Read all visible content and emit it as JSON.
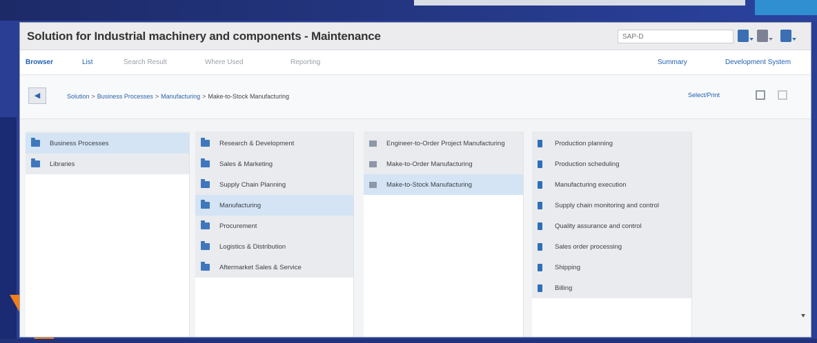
{
  "window": {
    "title": "Solution for Industrial machinery and components - Maintenance",
    "search_placeholder": "SAP-D"
  },
  "tabs": [
    {
      "label": "Browser"
    },
    {
      "label": "List"
    },
    {
      "label": "Search Result"
    },
    {
      "label": "Where Used"
    },
    {
      "label": "Reporting"
    }
  ],
  "right_menus": {
    "summary": "Summary",
    "dev_system": "Development System"
  },
  "breadcrumb": {
    "items": [
      "Solution",
      "Business Processes",
      "Manufacturing",
      "Make-to-Stock Manufacturing"
    ]
  },
  "toolbar": {
    "select_menu": "Select/Print"
  },
  "columns": {
    "col1": [
      {
        "label": "Business Processes",
        "selected": true
      },
      {
        "label": "Libraries",
        "selected": false
      }
    ],
    "col2": [
      {
        "label": "Research & Development",
        "selected": false
      },
      {
        "label": "Sales & Marketing",
        "selected": false
      },
      {
        "label": "Supply Chain Planning",
        "selected": false
      },
      {
        "label": "Manufacturing",
        "selected": true
      },
      {
        "label": "Procurement",
        "selected": false
      },
      {
        "label": "Logistics & Distribution",
        "selected": false
      },
      {
        "label": "Aftermarket Sales & Service",
        "selected": false
      }
    ],
    "col3": [
      {
        "label": "Engineer-to-Order Project Manufacturing",
        "selected": false
      },
      {
        "label": "Make-to-Order Manufacturing",
        "selected": false
      },
      {
        "label": "Make-to-Stock Manufacturing",
        "selected": true
      }
    ],
    "col4": [
      {
        "label": "Production planning",
        "selected": false
      },
      {
        "label": "Production scheduling",
        "selected": false
      },
      {
        "label": "Manufacturing execution",
        "selected": false
      },
      {
        "label": "Supply chain monitoring and control",
        "selected": false
      },
      {
        "label": "Quality assurance and control",
        "selected": false
      },
      {
        "label": "Sales order processing",
        "selected": false
      },
      {
        "label": "Shipping",
        "selected": false
      },
      {
        "label": "Billing",
        "selected": false
      }
    ]
  },
  "colors": {
    "accent": "#1f5fb0",
    "selection": "#d4e4f4",
    "orange": "#f07f1a",
    "backdrop": "#2a3f94"
  },
  "icons": {
    "folder": "folder-icon",
    "table": "table-icon",
    "document": "document-icon"
  }
}
